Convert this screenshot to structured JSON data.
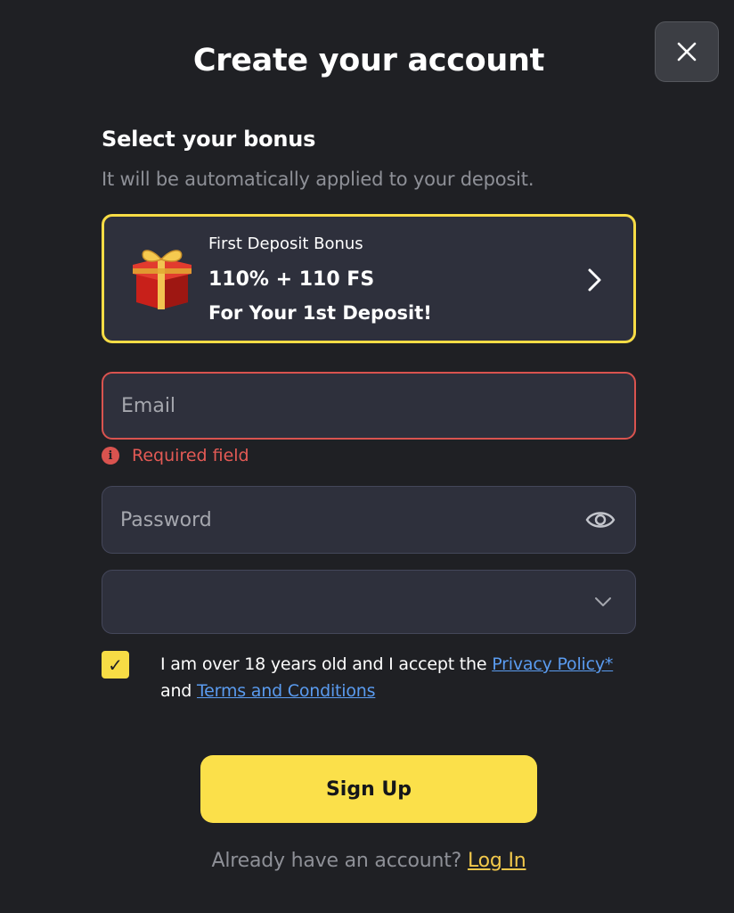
{
  "header": {
    "title": "Create your account",
    "close_icon": "close-icon"
  },
  "bonus": {
    "section_title": "Select your bonus",
    "section_subtitle": "It will be automatically applied to your deposit.",
    "card": {
      "name": "First Deposit Bonus",
      "amount": "110% + 110 FS",
      "description": "For Your 1st Deposit!",
      "icon": "gift-icon",
      "arrow_icon": "chevron-right-icon"
    }
  },
  "form": {
    "email": {
      "placeholder": "Email",
      "value": ""
    },
    "email_error": "Required field",
    "password": {
      "placeholder": "Password",
      "value": "",
      "toggle_icon": "eye-icon"
    },
    "select": {
      "value": "",
      "icon": "chevron-down-icon"
    },
    "consent": {
      "checked": true,
      "text_before": "I am over 18 years old and I accept the ",
      "privacy_link": "Privacy Policy*",
      "text_middle": " and ",
      "terms_link": "Terms and Conditions"
    },
    "submit_label": "Sign Up"
  },
  "footer": {
    "prompt": "Already have an account? ",
    "login_link": "Log In"
  },
  "colors": {
    "background": "#1f2024",
    "accent": "#f7dc45",
    "error": "#d9534f",
    "link": "#5a9bef"
  }
}
